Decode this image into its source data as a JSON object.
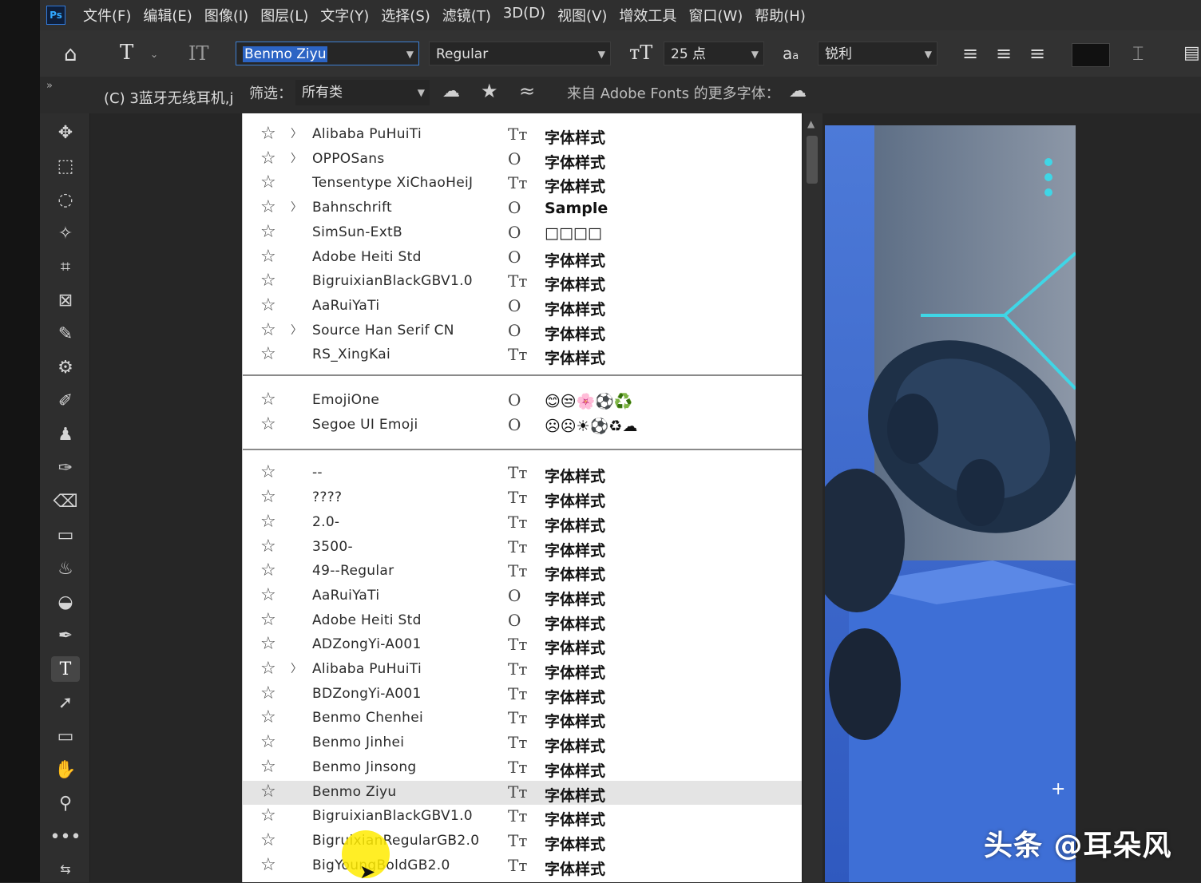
{
  "menubar": {
    "logo": "Ps",
    "items": [
      "文件(F)",
      "编辑(E)",
      "图像(I)",
      "图层(L)",
      "文字(Y)",
      "选择(S)",
      "滤镜(T)",
      "3D(D)",
      "视图(V)",
      "增效工具",
      "窗口(W)",
      "帮助(H)"
    ]
  },
  "options": {
    "font_family": "Benmo Ziyu",
    "font_style": "Regular",
    "font_size": "25 点",
    "aa_icon_label": "a",
    "aa_small": "a",
    "antialias": "锐利"
  },
  "subbar": {
    "layer_name": "(C) 3蓝牙无线耳机,j",
    "filter_label": "筛选：",
    "filter_value": "所有类",
    "more_fonts": "来自 Adobe Fonts 的更多字体："
  },
  "fonts": {
    "recent": [
      {
        "name": "Alibaba PuHuiTi",
        "expand": true,
        "type": "Tт",
        "sample": "字体样式"
      },
      {
        "name": "OPPOSans",
        "expand": true,
        "type": "O",
        "sample": "字体样式"
      },
      {
        "name": "Tensentype XiChaoHeiJ",
        "expand": false,
        "type": "Tт",
        "sample": "字体样式"
      },
      {
        "name": "Bahnschrift",
        "expand": true,
        "type": "O",
        "sample": "Sample"
      },
      {
        "name": "SimSun-ExtB",
        "expand": false,
        "type": "O",
        "sample": "□□□□"
      },
      {
        "name": "Adobe Heiti Std",
        "expand": false,
        "type": "O",
        "sample": "字体样式"
      },
      {
        "name": "BigruixianBlackGBV1.0",
        "expand": false,
        "type": "Tт",
        "sample": "字体样式"
      },
      {
        "name": "AaRuiYaTi",
        "expand": false,
        "type": "O",
        "sample": "字体样式"
      },
      {
        "name": "Source Han Serif CN",
        "expand": true,
        "type": "O",
        "sample": "字体样式"
      },
      {
        "name": "RS_XingKai",
        "expand": false,
        "type": "Tт",
        "sample": "字体样式"
      }
    ],
    "emoji": [
      {
        "name": "EmojiOne",
        "expand": false,
        "type": "O",
        "sample": "😊😒🌸⚽♻️"
      },
      {
        "name": "Segoe UI Emoji",
        "expand": false,
        "type": "O",
        "sample": "☹☹☀⚽♻☁"
      }
    ],
    "all": [
      {
        "name": "--",
        "expand": false,
        "type": "Tт",
        "sample": "字体样式",
        "selected": false
      },
      {
        "name": "????",
        "expand": false,
        "type": "Tт",
        "sample": "字体样式",
        "selected": false
      },
      {
        "name": "2.0-",
        "expand": false,
        "type": "Tт",
        "sample": "字体样式",
        "selected": false
      },
      {
        "name": "3500-",
        "expand": false,
        "type": "Tт",
        "sample": "字体样式",
        "selected": false
      },
      {
        "name": "49--Regular",
        "expand": false,
        "type": "Tт",
        "sample": "字体样式",
        "selected": false
      },
      {
        "name": "AaRuiYaTi",
        "expand": false,
        "type": "O",
        "sample": "字体样式",
        "selected": false
      },
      {
        "name": "Adobe Heiti Std",
        "expand": false,
        "type": "O",
        "sample": "字体样式",
        "selected": false
      },
      {
        "name": "ADZongYi-A001",
        "expand": false,
        "type": "Tт",
        "sample": "字体样式",
        "selected": false
      },
      {
        "name": "Alibaba PuHuiTi",
        "expand": true,
        "type": "Tт",
        "sample": "字体样式",
        "selected": false
      },
      {
        "name": "BDZongYi-A001",
        "expand": false,
        "type": "Tт",
        "sample": "字体样式",
        "selected": false
      },
      {
        "name": "Benmo Chenhei",
        "expand": false,
        "type": "Tт",
        "sample": "字体样式",
        "selected": false
      },
      {
        "name": "Benmo Jinhei",
        "expand": false,
        "type": "Tт",
        "sample": "字体样式",
        "selected": false
      },
      {
        "name": "Benmo Jinsong",
        "expand": false,
        "type": "Tт",
        "sample": "字体样式",
        "selected": false
      },
      {
        "name": "Benmo Ziyu",
        "expand": false,
        "type": "Tт",
        "sample": "字体样式",
        "selected": true
      },
      {
        "name": "BigruixianBlackGBV1.0",
        "expand": false,
        "type": "Tт",
        "sample": "字体样式",
        "selected": false
      },
      {
        "name": "BigruixianRegularGB2.0",
        "expand": false,
        "type": "Tт",
        "sample": "字体样式",
        "selected": false
      },
      {
        "name": "BigYoungBoldGB2.0",
        "expand": false,
        "type": "Tт",
        "sample": "字体样式",
        "selected": false
      }
    ]
  },
  "watermark": "头条 @耳朵风",
  "colors": {
    "accent": "#2c64c4",
    "canvas_blue": "#3a6bd3",
    "cyan": "#3fd6e6"
  }
}
